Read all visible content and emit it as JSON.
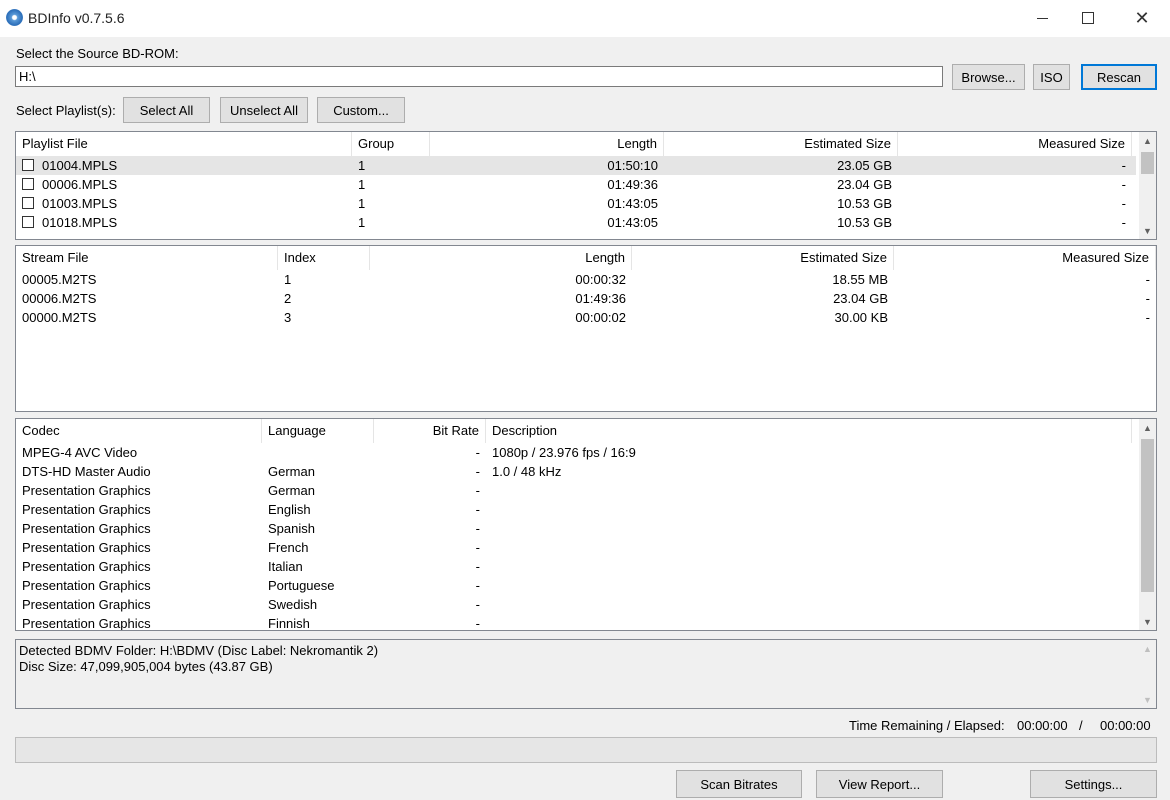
{
  "window": {
    "title": "BDInfo v0.7.5.6"
  },
  "source": {
    "label": "Select the Source BD-ROM:",
    "path": "H:\\",
    "browse_label": "Browse...",
    "iso_label": "ISO",
    "rescan_label": "Rescan"
  },
  "playlist_select": {
    "label": "Select Playlist(s):",
    "select_all_label": "Select All",
    "unselect_all_label": "Unselect All",
    "custom_label": "Custom..."
  },
  "playlists": {
    "columns": [
      "Playlist File",
      "Group",
      "Length",
      "Estimated Size",
      "Measured Size"
    ],
    "rows": [
      {
        "file": "01004.MPLS",
        "group": "1",
        "length": "01:50:10",
        "est": "23.05 GB",
        "meas": "-"
      },
      {
        "file": "00006.MPLS",
        "group": "1",
        "length": "01:49:36",
        "est": "23.04 GB",
        "meas": "-"
      },
      {
        "file": "01003.MPLS",
        "group": "1",
        "length": "01:43:05",
        "est": "10.53 GB",
        "meas": "-"
      },
      {
        "file": "01018.MPLS",
        "group": "1",
        "length": "01:43:05",
        "est": "10.53 GB",
        "meas": "-"
      }
    ]
  },
  "streams": {
    "columns": [
      "Stream File",
      "Index",
      "Length",
      "Estimated Size",
      "Measured Size"
    ],
    "rows": [
      {
        "file": "00005.M2TS",
        "index": "1",
        "length": "00:00:32",
        "est": "18.55 MB",
        "meas": "-"
      },
      {
        "file": "00006.M2TS",
        "index": "2",
        "length": "01:49:36",
        "est": "23.04 GB",
        "meas": "-"
      },
      {
        "file": "00000.M2TS",
        "index": "3",
        "length": "00:00:02",
        "est": "30.00 KB",
        "meas": "-"
      }
    ]
  },
  "codecs": {
    "columns": [
      "Codec",
      "Language",
      "Bit Rate",
      "Description"
    ],
    "rows": [
      {
        "codec": "MPEG-4 AVC Video",
        "lang": "",
        "rate": "-",
        "desc": "1080p / 23.976 fps / 16:9"
      },
      {
        "codec": "DTS-HD Master Audio",
        "lang": "German",
        "rate": "-",
        "desc": "1.0 / 48 kHz"
      },
      {
        "codec": "Presentation Graphics",
        "lang": "German",
        "rate": "-",
        "desc": ""
      },
      {
        "codec": "Presentation Graphics",
        "lang": "English",
        "rate": "-",
        "desc": ""
      },
      {
        "codec": "Presentation Graphics",
        "lang": "Spanish",
        "rate": "-",
        "desc": ""
      },
      {
        "codec": "Presentation Graphics",
        "lang": "French",
        "rate": "-",
        "desc": ""
      },
      {
        "codec": "Presentation Graphics",
        "lang": "Italian",
        "rate": "-",
        "desc": ""
      },
      {
        "codec": "Presentation Graphics",
        "lang": "Portuguese",
        "rate": "-",
        "desc": ""
      },
      {
        "codec": "Presentation Graphics",
        "lang": "Swedish",
        "rate": "-",
        "desc": ""
      },
      {
        "codec": "Presentation Graphics",
        "lang": "Finnish",
        "rate": "-",
        "desc": ""
      }
    ]
  },
  "status": {
    "line1": "Detected BDMV Folder: H:\\BDMV (Disc Label: Nekromantik 2)",
    "line2": "Disc Size: 47,099,905,004 bytes (43.87 GB)"
  },
  "timer": {
    "label": "Time Remaining / Elapsed:",
    "remaining": "00:00:00",
    "separator": "/",
    "elapsed": "00:00:00"
  },
  "progress": {
    "value": 0
  },
  "footer": {
    "scan_label": "Scan Bitrates",
    "report_label": "View Report...",
    "settings_label": "Settings..."
  },
  "icons": {
    "app": "disc-icon",
    "minimize": "minimize-icon",
    "maximize": "maximize-icon",
    "close": "close-icon",
    "scroll_up": "chevron-up-icon",
    "scroll_down": "chevron-down-icon"
  }
}
